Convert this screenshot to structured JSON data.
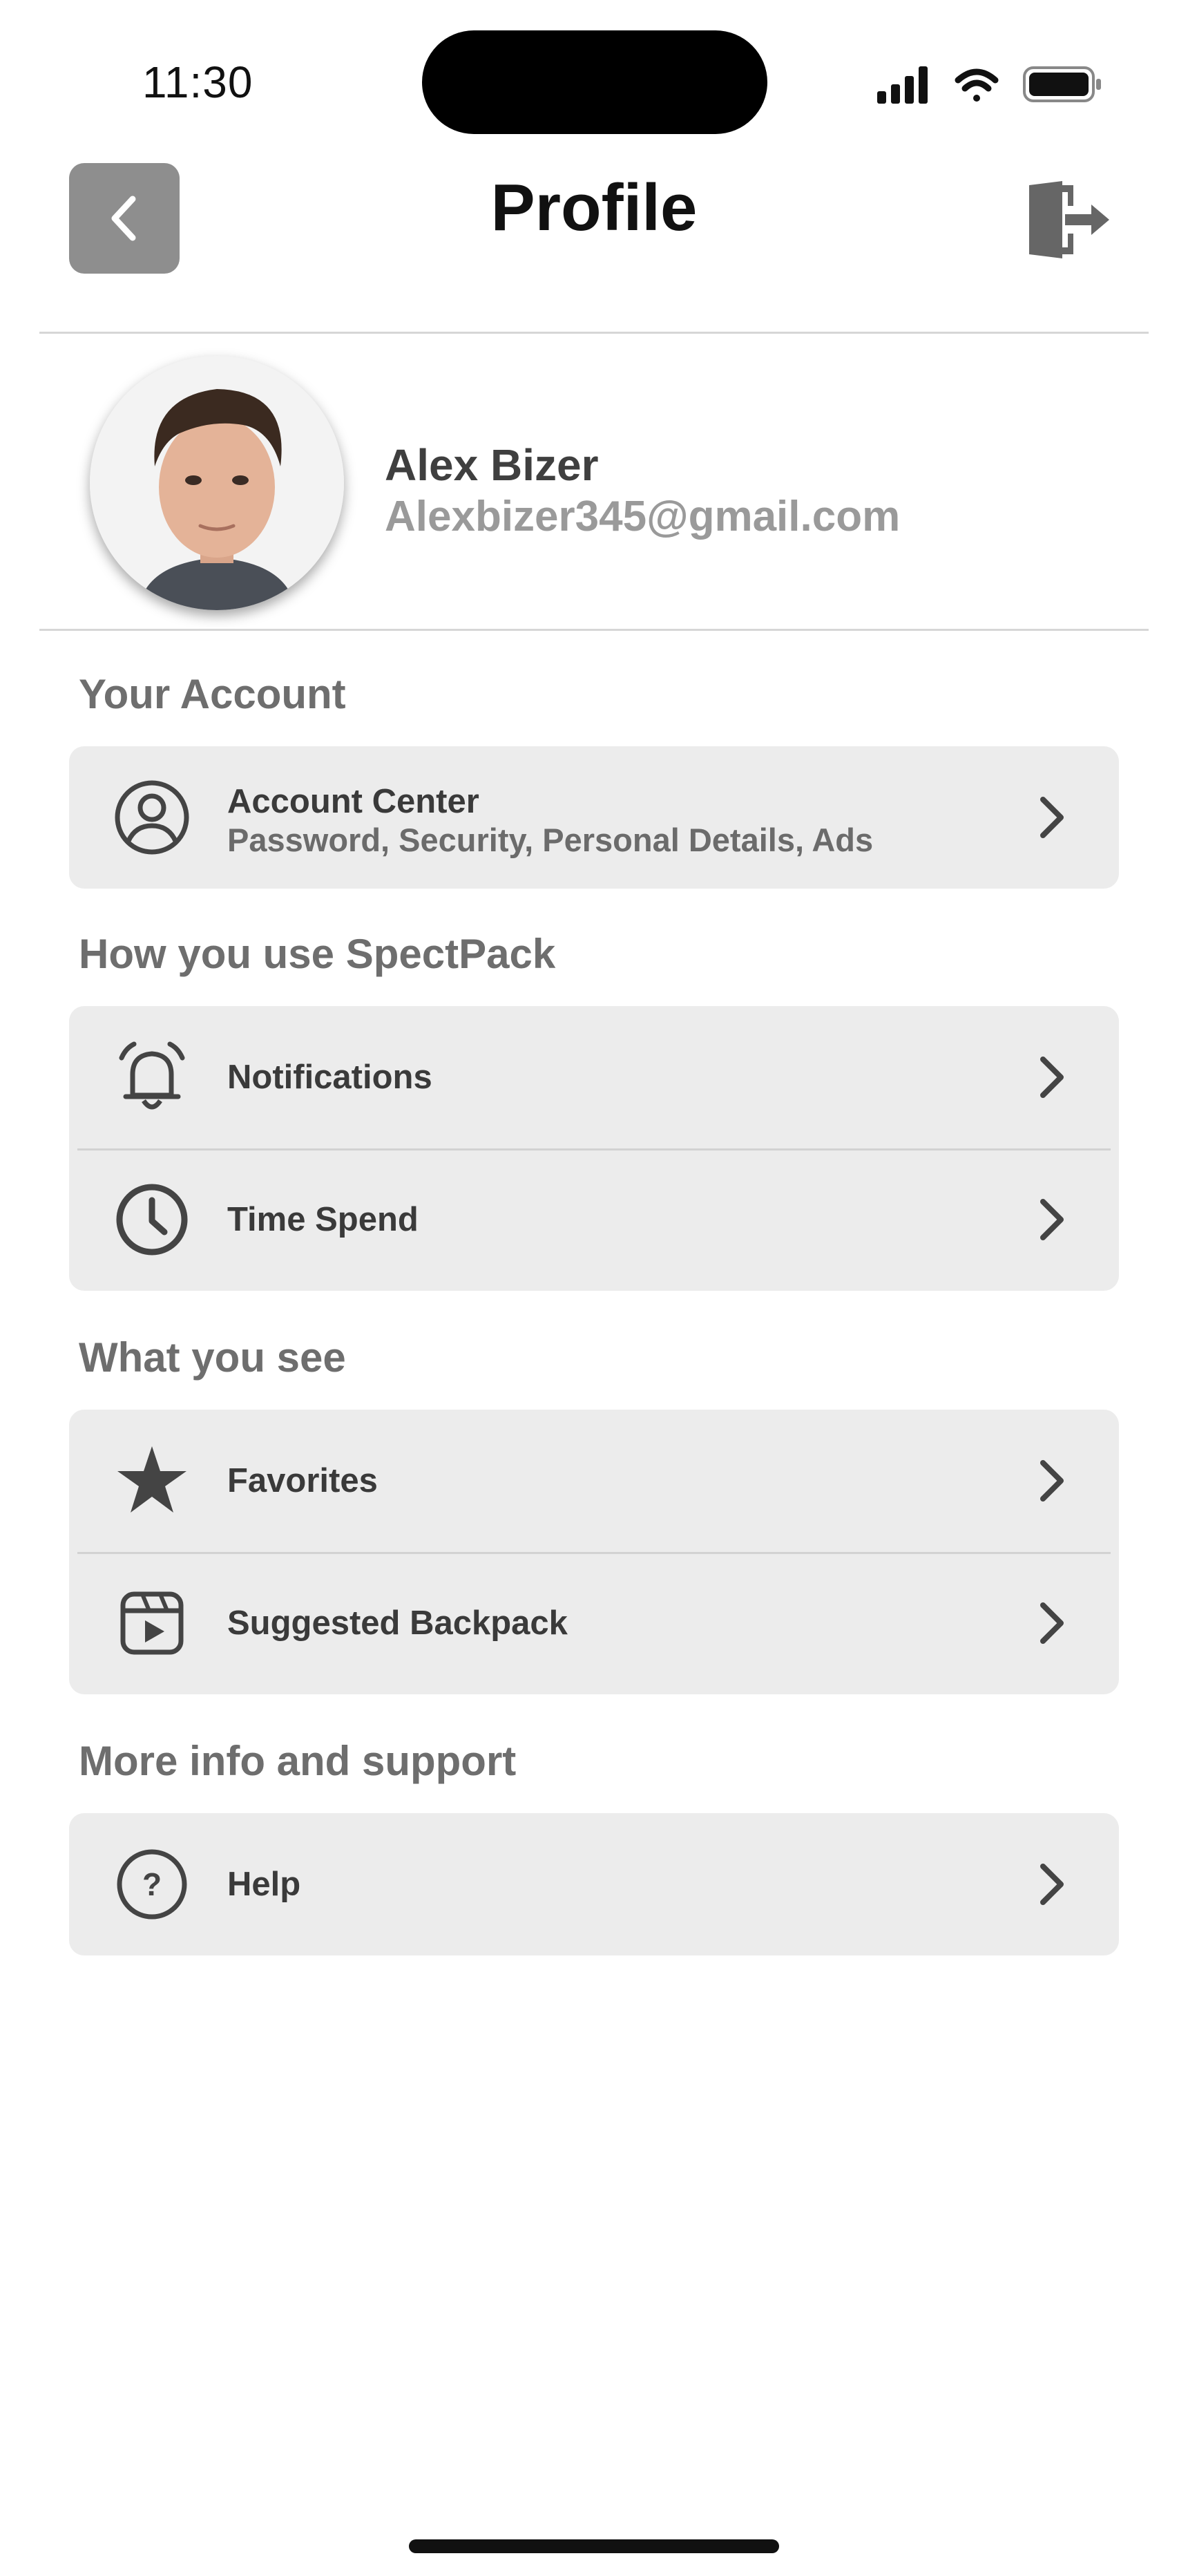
{
  "status_bar": {
    "time": "11:30"
  },
  "header": {
    "title": "Profile"
  },
  "profile": {
    "name": "Alex Bizer",
    "email": "Alexbizer345@gmail.com"
  },
  "sections": [
    {
      "title": "Your Account",
      "items": [
        {
          "label": "Account Center",
          "sublabel": "Password, Security, Personal Details, Ads",
          "icon": "user-circle-icon"
        }
      ]
    },
    {
      "title": "How you use SpectPack",
      "items": [
        {
          "label": "Notifications",
          "icon": "bell-icon"
        },
        {
          "label": "Time Spend",
          "icon": "clock-icon"
        }
      ]
    },
    {
      "title": "What you see",
      "items": [
        {
          "label": "Favorites",
          "icon": "star-icon"
        },
        {
          "label": "Suggested Backpack",
          "icon": "video-play-icon"
        }
      ]
    },
    {
      "title": "More info and support",
      "items": [
        {
          "label": "Help",
          "icon": "help-circle-icon"
        }
      ]
    }
  ],
  "colors": {
    "card_bg": "#ececec",
    "back_button_bg": "#8e8e8e",
    "email": "#9a9a9a"
  }
}
